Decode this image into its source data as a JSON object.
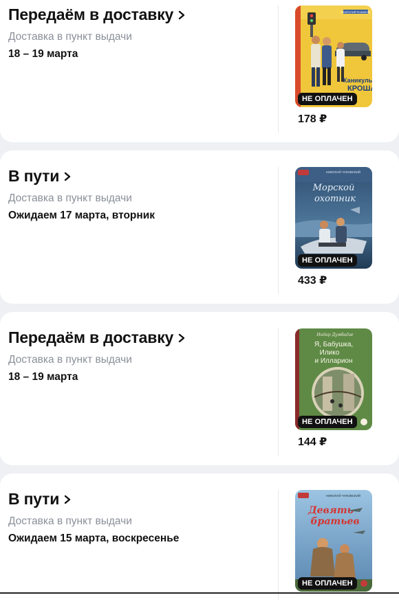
{
  "orders": [
    {
      "status": "Передаём в доставку",
      "method": "Доставка в пункт выдачи",
      "date": "18 – 19 марта",
      "badge": "НЕ ОПЛАЧЕН",
      "price": "178 ₽",
      "cover_title_lines": [
        "Каникулы",
        "КРОША"
      ],
      "cover_author": "АНАТОЛИЙ РЫБАКОВ"
    },
    {
      "status": "В пути",
      "method": "Доставка в пункт выдачи",
      "date": "Ожидаем 17 марта, вторник",
      "badge": "НЕ ОПЛАЧЕН",
      "price": "433 ₽",
      "cover_title_lines": [
        "Морской",
        "охотник"
      ],
      "cover_author": "НИКОЛАЙ ЧУКОВСКИЙ"
    },
    {
      "status": "Передаём в доставку",
      "method": "Доставка в пункт выдачи",
      "date": "18 – 19 марта",
      "badge": "НЕ ОПЛАЧЕН",
      "price": "144 ₽",
      "cover_title_lines": [
        "Я, Бабушка,",
        "Илико",
        "и Илларион"
      ],
      "cover_author": "Нодар Думбадзе"
    },
    {
      "status": "В пути",
      "method": "Доставка в пункт выдачи",
      "date": "Ожидаем 15 марта, воскресенье",
      "badge": "НЕ ОПЛАЧЕН",
      "price": "",
      "cover_title_lines": [
        "Девять",
        "братьев"
      ],
      "cover_author": "НИКОЛАЙ ЧУКОВСКИЙ"
    }
  ],
  "colors": {
    "accent_text": "#111111",
    "muted_text": "#8a8f98",
    "badge_bg": "#111111",
    "page_bg": "#eef0f3"
  }
}
